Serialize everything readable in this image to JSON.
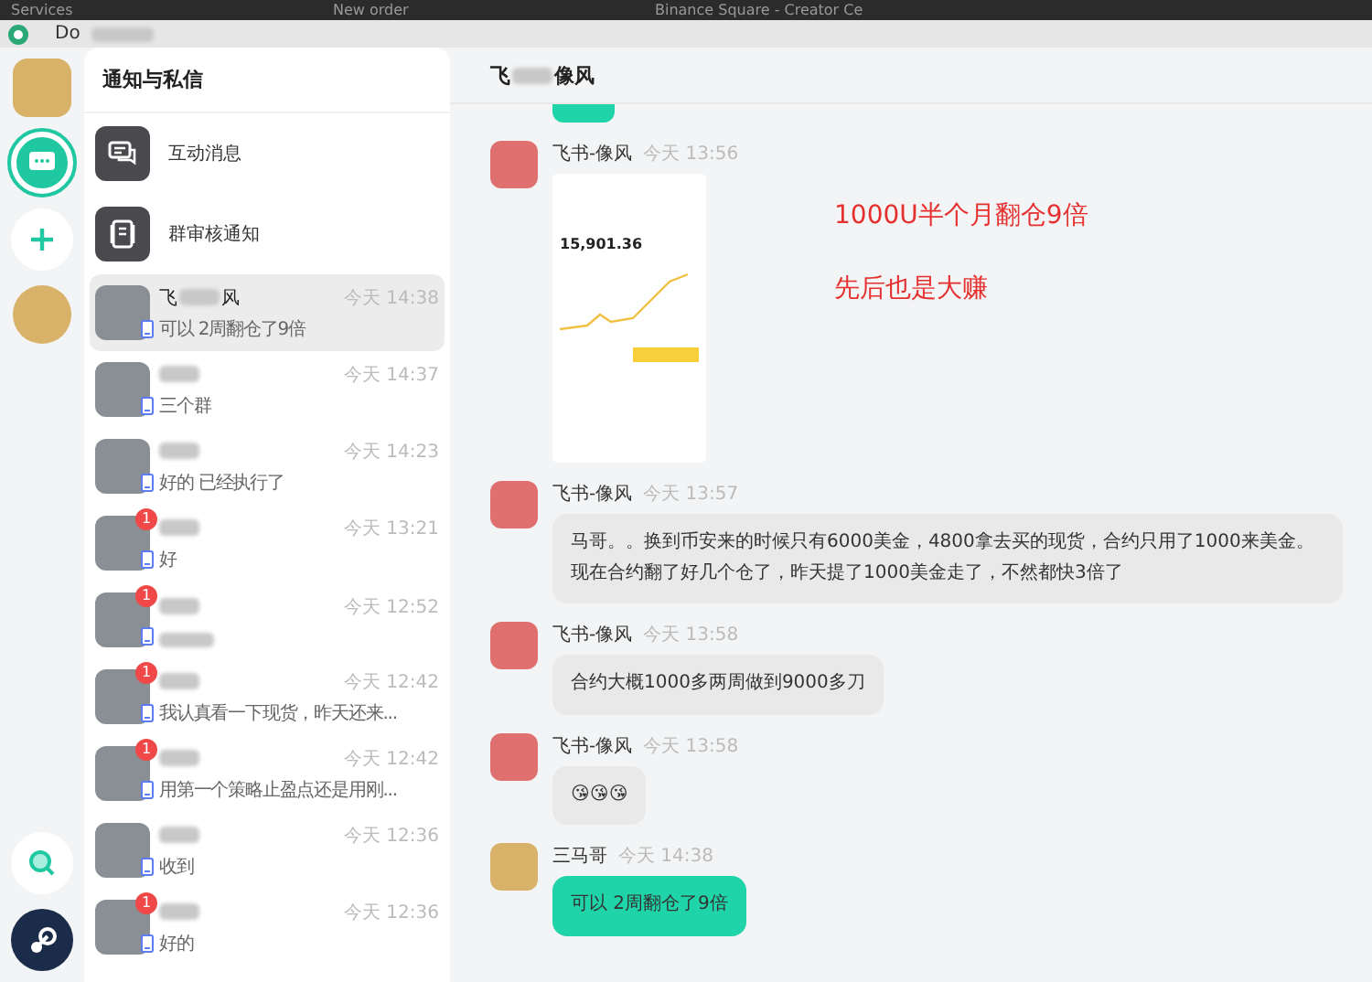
{
  "browser_tabs": [
    {
      "label": "Services"
    },
    {
      "label": "New order"
    },
    {
      "label": "Binance Square - Creator Ce"
    }
  ],
  "window": {
    "title": "Do"
  },
  "rail": {
    "items": [
      {
        "kind": "avatar"
      },
      {
        "kind": "messages",
        "selected": true
      },
      {
        "kind": "add",
        "selected": false
      },
      {
        "kind": "avatar"
      }
    ],
    "bottom": [
      {
        "kind": "search"
      },
      {
        "kind": "steam"
      }
    ]
  },
  "notifications": {
    "title": "通知与私信",
    "items": [
      {
        "kind": "interaction",
        "label": "互动消息"
      },
      {
        "kind": "group",
        "label": "群审核通知"
      }
    ]
  },
  "chats": [
    {
      "name_start": "飞",
      "name_end": "风",
      "time": "今天 14:38",
      "preview": "可以 2周翻仓了9倍",
      "selected": true
    },
    {
      "time": "今天 14:37",
      "preview": "三个群",
      "selected": false
    },
    {
      "time": "今天 14:23",
      "preview": "好的 已经执行了",
      "selected": false
    },
    {
      "time": "今天 13:21",
      "preview": "好",
      "unread": "1",
      "selected": false
    },
    {
      "time": "今天 12:52",
      "unread": "1",
      "selected": false
    },
    {
      "time": "今天 12:42",
      "preview": "我认真看一下现货，昨天还来...",
      "unread": "1",
      "selected": false
    },
    {
      "time": "今天 12:42",
      "preview": "用第一个策略止盈点还是用刚...",
      "unread": "1",
      "selected": false
    },
    {
      "time": "今天 12:36",
      "preview": "收到",
      "selected": false
    },
    {
      "time": "今天 12:36",
      "preview": "好的",
      "unread": "1",
      "selected": false
    }
  ],
  "chat": {
    "title_start": "飞",
    "title_end": "像风",
    "messages": [
      {
        "kind": "cut",
        "mine": true
      },
      {
        "kind": "image",
        "mine": false,
        "sender": "飞书-像风",
        "time": "今天 13:56",
        "image_value": "15,901.36",
        "annotations": [
          "1000U半个月翻仓9倍",
          "先后也是大赚"
        ]
      },
      {
        "kind": "text",
        "mine": false,
        "sender": "飞书-像风",
        "time": "今天 13:57",
        "text": "马哥。。换到币安来的时候只有6000美金，4800拿去买的现货，合约只用了1000来美金。现在合约翻了好几个仓了，昨天提了1000美金走了，不然都快3倍了"
      },
      {
        "kind": "text",
        "mine": false,
        "sender": "飞书-像风",
        "time": "今天 13:58",
        "text": "合约大概1000多两周做到9000多刀"
      },
      {
        "kind": "text",
        "mine": false,
        "sender": "飞书-像风",
        "time": "今天 13:58",
        "text": "😘😘😘"
      },
      {
        "kind": "text",
        "mine": true,
        "sender": "三马哥",
        "time": "今天 14:38",
        "text": "可以 2周翻仓了9倍"
      }
    ]
  }
}
